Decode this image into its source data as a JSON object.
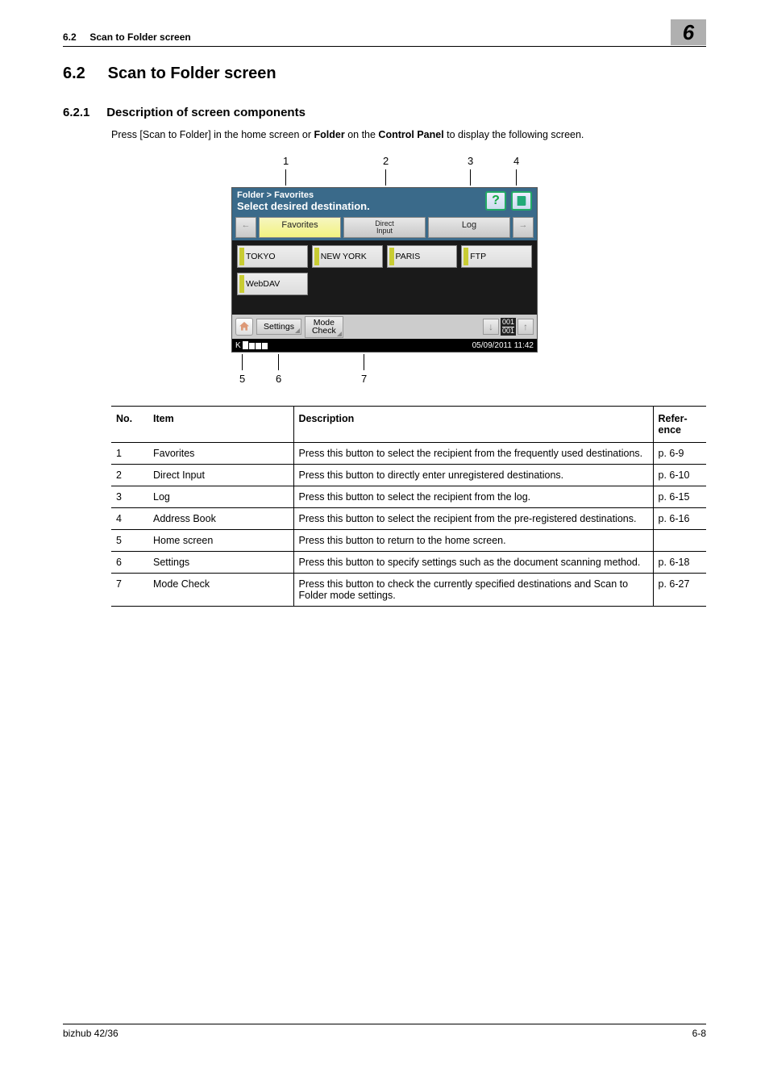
{
  "header": {
    "section_ref": "6.2",
    "section_name": "Scan to Folder screen",
    "chapter_badge": "6"
  },
  "section": {
    "number": "6.2",
    "title": "Scan to Folder screen"
  },
  "subsection": {
    "number": "6.2.1",
    "title": "Description of screen components"
  },
  "intro": {
    "pre": "Press [Scan to Folder] in the home screen or ",
    "b1": "Folder",
    "mid": " on the ",
    "b2": "Control Panel",
    "post": " to display the following screen."
  },
  "callouts": {
    "top": [
      "1",
      "2",
      "3",
      "4"
    ],
    "bottom": [
      "5",
      "6",
      "7"
    ]
  },
  "device": {
    "breadcrumb": "Folder > Favorites",
    "prompt": "Select desired destination.",
    "help": "?",
    "tabs": {
      "left_arrow": "←",
      "favorites": "Favorites",
      "direct1": "Direct",
      "direct2": "Input",
      "log": "Log",
      "right_arrow": "→"
    },
    "dest": [
      "TOKYO",
      "NEW YORK",
      "PARIS",
      "FTP",
      "WebDAV"
    ],
    "settings": "Settings",
    "mode1": "Mode",
    "mode2": "Check",
    "page_top": "001",
    "page_bot": "001",
    "status_k": "K",
    "datetime": "05/09/2011 11:42"
  },
  "table": {
    "headers": {
      "no": "No.",
      "item": "Item",
      "desc": "Description",
      "ref": "Refer-\nence"
    },
    "rows": [
      {
        "no": "1",
        "item": "Favorites",
        "desc": "Press this button to select the recipient from the frequently used destinations.",
        "ref": "p. 6-9"
      },
      {
        "no": "2",
        "item": "Direct Input",
        "desc": "Press this button to directly enter unregistered destinations.",
        "ref": "p. 6-10"
      },
      {
        "no": "3",
        "item": "Log",
        "desc": "Press this button to select the recipient from the log.",
        "ref": "p. 6-15"
      },
      {
        "no": "4",
        "item": "Address Book",
        "desc": "Press this button to select the recipient from the pre-registered destinations.",
        "ref": "p. 6-16"
      },
      {
        "no": "5",
        "item": "Home screen",
        "desc": "Press this button to return to the home screen.",
        "ref": ""
      },
      {
        "no": "6",
        "item": "Settings",
        "desc": "Press this button to specify settings such as the document scanning method.",
        "ref": "p. 6-18"
      },
      {
        "no": "7",
        "item": "Mode Check",
        "desc": "Press this button to check the currently specified destinations and Scan to Folder mode settings.",
        "ref": "p. 6-27"
      }
    ]
  },
  "footer": {
    "left": "bizhub 42/36",
    "right": "6-8"
  }
}
